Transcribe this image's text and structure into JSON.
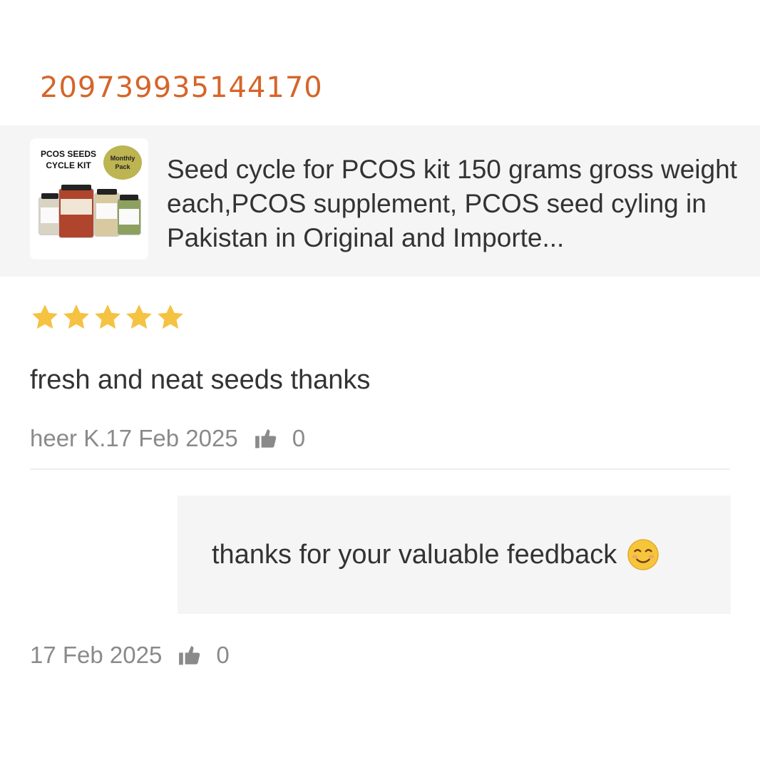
{
  "order": {
    "id": "209739935144170"
  },
  "product": {
    "title": "Seed cycle for PCOS kit 150 grams gross weight each,PCOS supplement, PCOS seed cyling in Pakistan in Original and Importe...",
    "thumbnail": {
      "title": "PCOS SEEDS CYCLE KIT",
      "badge": "Monthly Pack"
    }
  },
  "review": {
    "rating": 5,
    "rating_max": 5,
    "text": "fresh and neat seeds thanks",
    "author_date": "heer K.17 Feb 2025",
    "likes": "0"
  },
  "reply": {
    "text": "thanks for your valuable feedback",
    "emoji": "smiling-face-icon",
    "date": "17 Feb 2025",
    "likes": "0"
  },
  "colors": {
    "order_id": "#d5652a",
    "star": "#f5c242",
    "card_bg": "#f5f5f5",
    "meta_text": "#8a8a8a"
  }
}
